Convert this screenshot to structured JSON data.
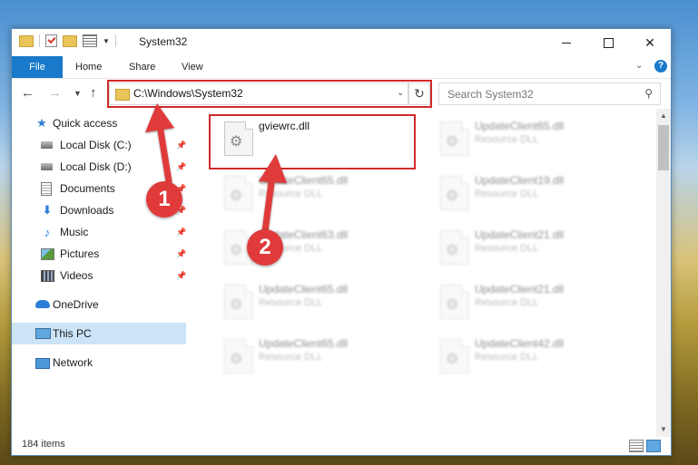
{
  "window": {
    "title": "System32"
  },
  "ribbon": {
    "tabs": [
      "File",
      "Home",
      "Share",
      "View"
    ]
  },
  "navigation": {
    "address_path": "C:\\Windows\\System32",
    "search_placeholder": "Search System32"
  },
  "sidebar": {
    "items": [
      {
        "label": "Quick access",
        "icon": "star-icon",
        "pinned": false
      },
      {
        "label": "Local Disk (C:)",
        "icon": "drive-icon",
        "pinned": true
      },
      {
        "label": "Local Disk (D:)",
        "icon": "drive-icon",
        "pinned": true
      },
      {
        "label": "Documents",
        "icon": "document-icon",
        "pinned": true
      },
      {
        "label": "Downloads",
        "icon": "download-icon",
        "pinned": true
      },
      {
        "label": "Music",
        "icon": "music-icon",
        "pinned": true
      },
      {
        "label": "Pictures",
        "icon": "pictures-icon",
        "pinned": true
      },
      {
        "label": "Videos",
        "icon": "videos-icon",
        "pinned": true
      },
      {
        "label": "OneDrive",
        "icon": "cloud-icon",
        "pinned": false
      },
      {
        "label": "This PC",
        "icon": "computer-icon",
        "pinned": false,
        "selected": true
      },
      {
        "label": "Network",
        "icon": "network-icon",
        "pinned": false
      }
    ]
  },
  "files": [
    {
      "name": "gviewrc.dll",
      "type": "",
      "highlighted": true
    },
    {
      "name": "UpdateClient65.dll",
      "type": "Resource DLL"
    },
    {
      "name": "UpdateClient65.dll",
      "type": "Resource DLL"
    },
    {
      "name": "UpdateClient19.dll",
      "type": "Resource DLL"
    },
    {
      "name": "UpdateClient63.dll",
      "type": "Resource DLL"
    },
    {
      "name": "UpdateClient21.dll",
      "type": "Resource DLL"
    },
    {
      "name": "UpdateClient65.dll",
      "type": "Resource DLL"
    },
    {
      "name": "UpdateClient21.dll",
      "type": "Resource DLL"
    },
    {
      "name": "UpdateClient65.dll",
      "type": "Resource DLL"
    },
    {
      "name": "UpdateClient42.dll",
      "type": "Resource DLL"
    }
  ],
  "status": {
    "item_count": "184 items"
  },
  "callouts": [
    "1",
    "2"
  ],
  "colors": {
    "accent": "#1979ca",
    "callout_red": "#e03a3a",
    "highlight_border": "#d02a2a"
  }
}
